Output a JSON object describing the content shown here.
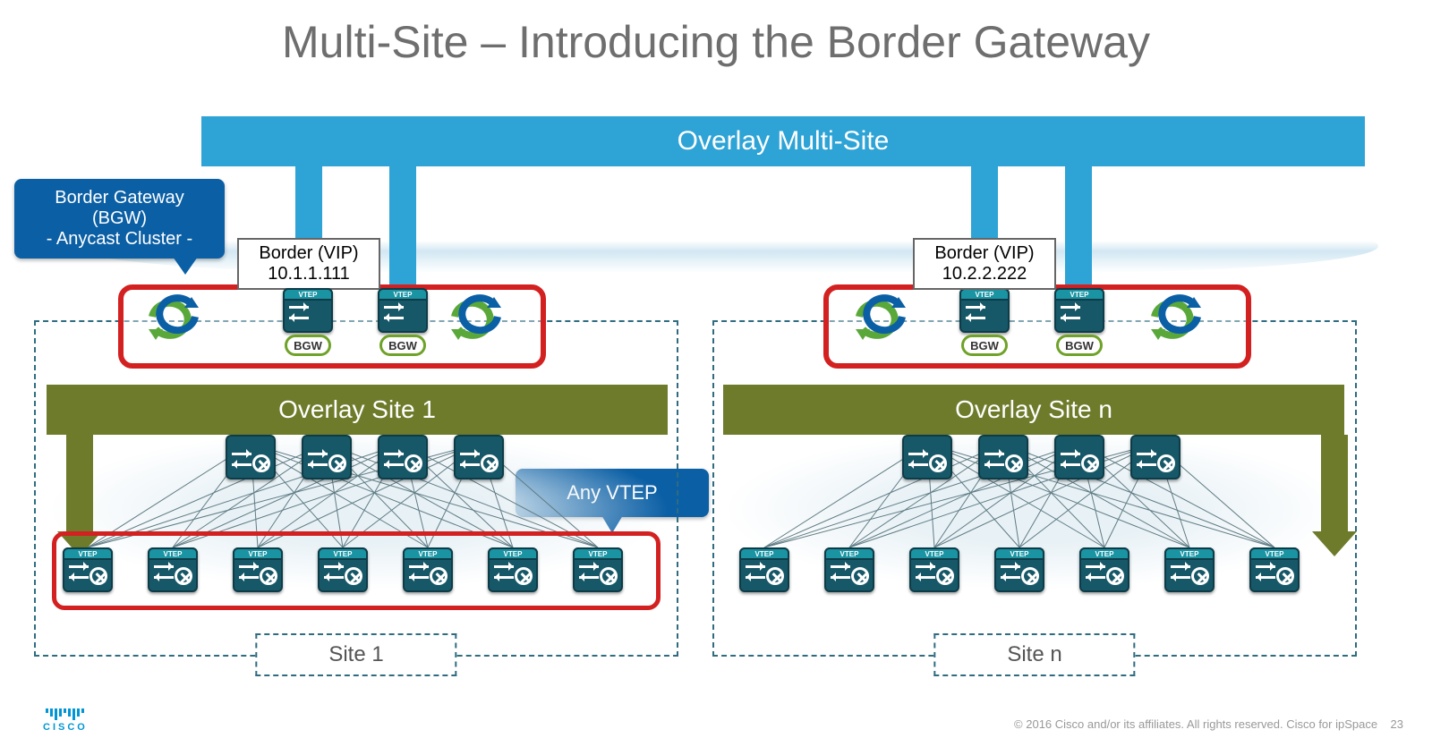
{
  "title": "Multi-Site – Introducing the Border Gateway",
  "overlay_multisite": "Overlay Multi-Site",
  "callouts": {
    "bgw_line1": "Border Gateway (BGW)",
    "bgw_line2": "- Anycast Cluster -",
    "any_vtep": "Any VTEP"
  },
  "sites": [
    {
      "idx": 0,
      "vip_label": "Border (VIP)",
      "vip_ip": "10.1.1.111",
      "overlay_label": "Overlay Site 1",
      "site_label": "Site 1",
      "bgw_pill": "BGW",
      "vtep_chip": "VTEP",
      "leaf_highlight": true
    },
    {
      "idx": 1,
      "vip_label": "Border (VIP)",
      "vip_ip": "10.2.2.222",
      "overlay_label": "Overlay Site n",
      "site_label": "Site n",
      "bgw_pill": "BGW",
      "vtep_chip": "VTEP",
      "leaf_highlight": false
    }
  ],
  "footer": {
    "copyright": "© 2016  Cisco and/or its affiliates. All rights reserved.    Cisco for ipSpace",
    "page": "23",
    "logo": "CISCO"
  },
  "colors": {
    "blue": "#2ea3d6",
    "darkblue": "#0b5fa5",
    "olive": "#6e7b2b",
    "red": "#d32020",
    "device": "#175868"
  }
}
